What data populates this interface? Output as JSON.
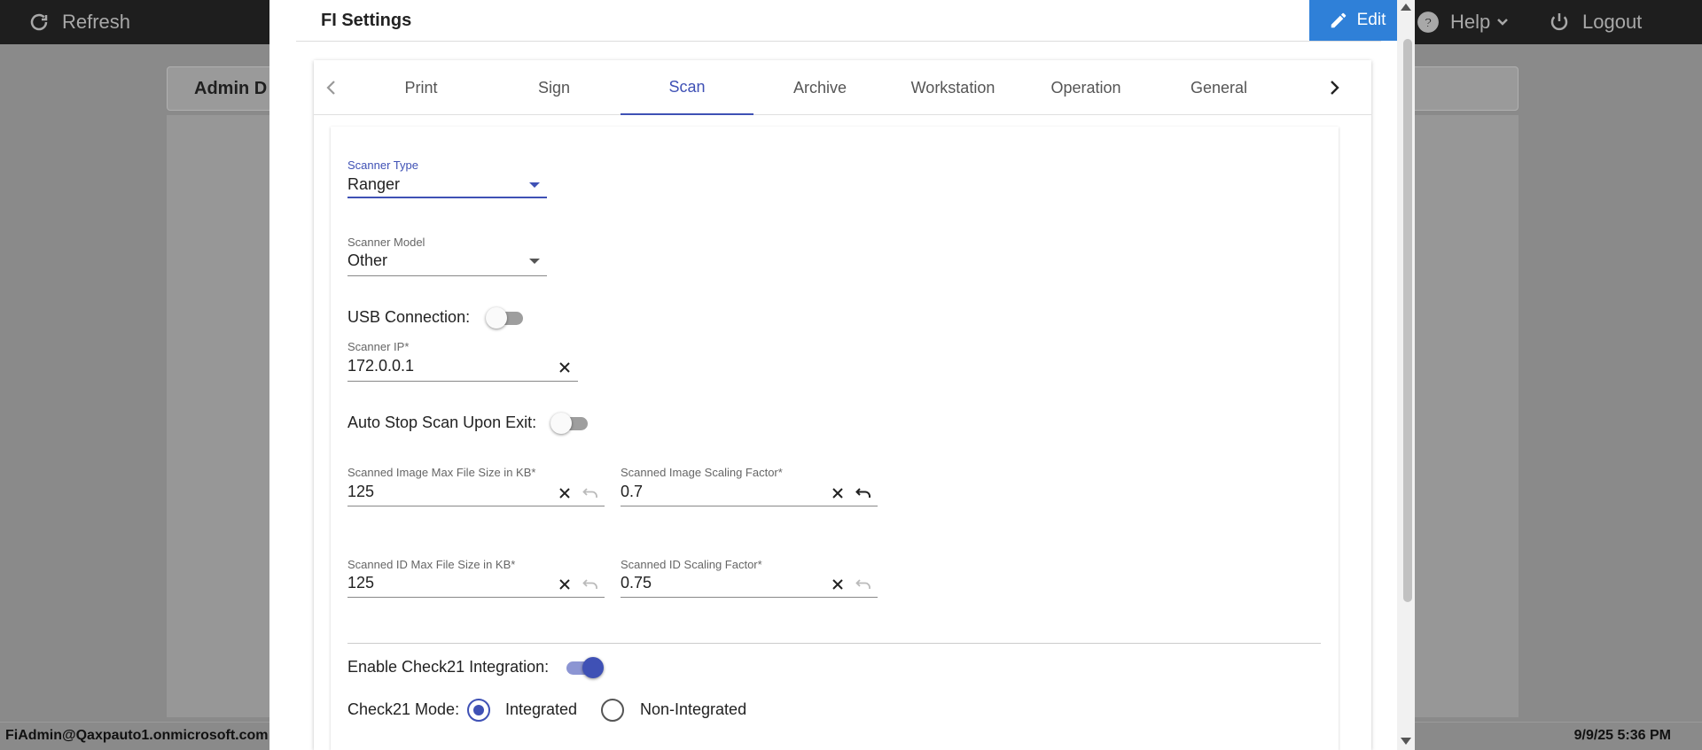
{
  "topbar": {
    "refresh_label": "Refresh",
    "help_label": "Help",
    "logout_label": "Logout"
  },
  "background": {
    "title": "Admin D",
    "footer_user": "FiAdmin@Qaxpauto1.onmicrosoft.com",
    "footer_time": "9/9/25 5:36 PM"
  },
  "dialog": {
    "title": "FI Settings",
    "edit_label": "Edit"
  },
  "tabs": [
    "Print",
    "Sign",
    "Scan",
    "Archive",
    "Workstation",
    "Operation",
    "General"
  ],
  "active_tab": "Scan",
  "scan": {
    "scanner_type": {
      "label": "Scanner Type",
      "value": "Ranger"
    },
    "scanner_model": {
      "label": "Scanner Model",
      "value": "Other"
    },
    "usb_connection": {
      "label": "USB Connection:",
      "on": false
    },
    "scanner_ip": {
      "label": "Scanner IP*",
      "value": "172.0.0.1"
    },
    "auto_stop": {
      "label": "Auto Stop Scan Upon Exit:",
      "on": false
    },
    "image_max_size": {
      "label": "Scanned Image Max File Size in KB*",
      "value": "125"
    },
    "image_scaling": {
      "label": "Scanned Image Scaling Factor*",
      "value": "0.7"
    },
    "id_max_size": {
      "label": "Scanned ID Max File Size in KB*",
      "value": "125"
    },
    "id_scaling": {
      "label": "Scanned ID Scaling Factor*",
      "value": "0.75"
    },
    "check21_enable": {
      "label": "Enable Check21 Integration:",
      "on": true
    },
    "check21_mode": {
      "label": "Check21 Mode:",
      "options": [
        "Integrated",
        "Non-Integrated"
      ],
      "selected": "Integrated"
    }
  },
  "colors": {
    "accent": "#3f51b5",
    "edit_button": "#2f80d8",
    "topbar": "#1e1e1e"
  }
}
